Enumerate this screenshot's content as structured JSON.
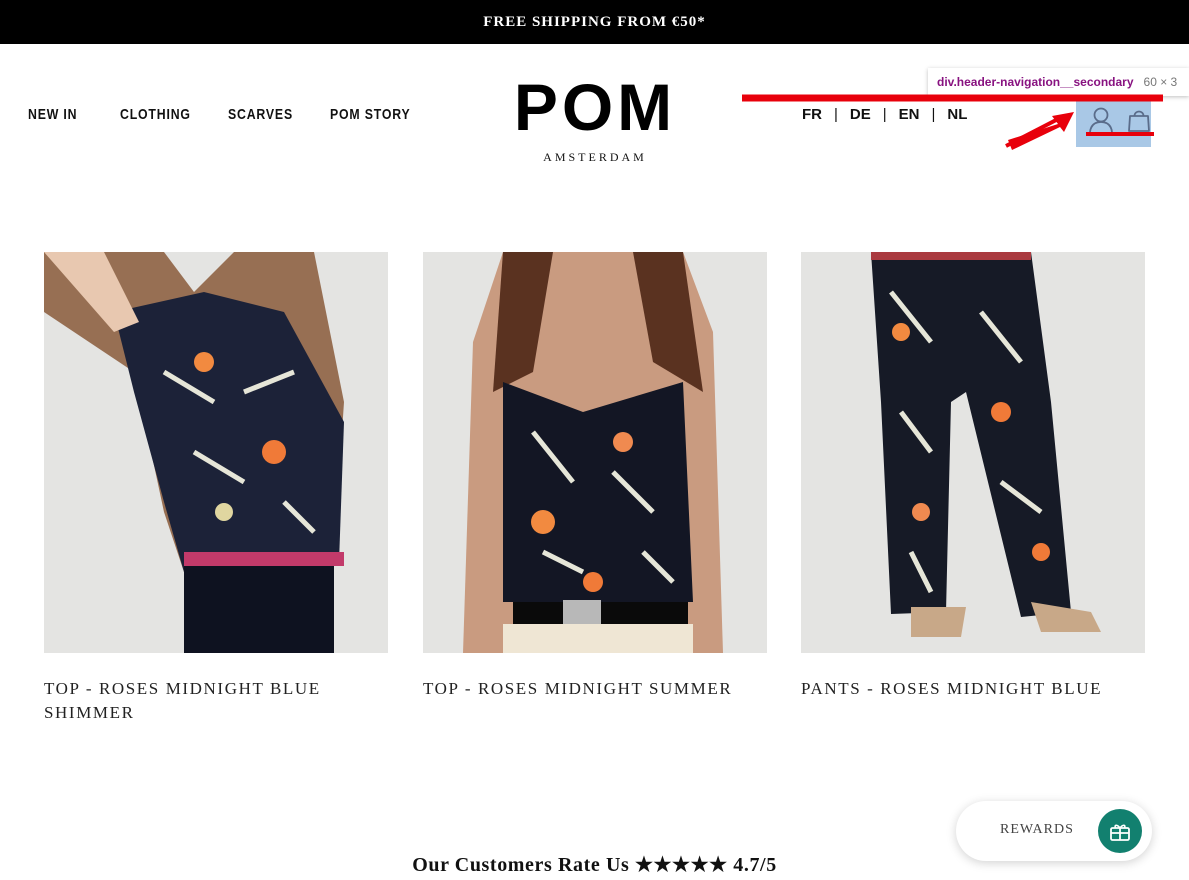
{
  "promo": {
    "text": "FREE SHIPPING FROM €50*"
  },
  "nav": {
    "items": [
      {
        "label": "NEW IN"
      },
      {
        "label": "CLOTHING"
      },
      {
        "label": "SCARVES"
      },
      {
        "label": "POM STORY"
      }
    ]
  },
  "logo": {
    "word": "POM",
    "sub": "AMSTERDAM"
  },
  "languages": [
    "FR",
    "DE",
    "EN",
    "NL"
  ],
  "language_separator": "|",
  "header_icons": {
    "account": "account-icon",
    "bag": "shopping-bag-icon"
  },
  "devtools_tooltip": {
    "selector": "div.header-navigation__secondary",
    "size": "60 × 3"
  },
  "products": [
    {
      "title": "TOP - ROSES MIDNIGHT BLUE SHIMMER"
    },
    {
      "title": "TOP - ROSES MIDNIGHT SUMMER"
    },
    {
      "title": "PANTS - ROSES MIDNIGHT BLUE"
    }
  ],
  "rating": {
    "text": "Our Customers Rate Us ★★★★★ 4.7/5"
  },
  "rewards": {
    "label": "REWARDS",
    "icon": "gift-icon"
  },
  "colors": {
    "promo_bg": "#000000",
    "highlight": "#a9c8e6",
    "annotation": "#e8000b",
    "rewards_icon_bg": "#12806f"
  }
}
